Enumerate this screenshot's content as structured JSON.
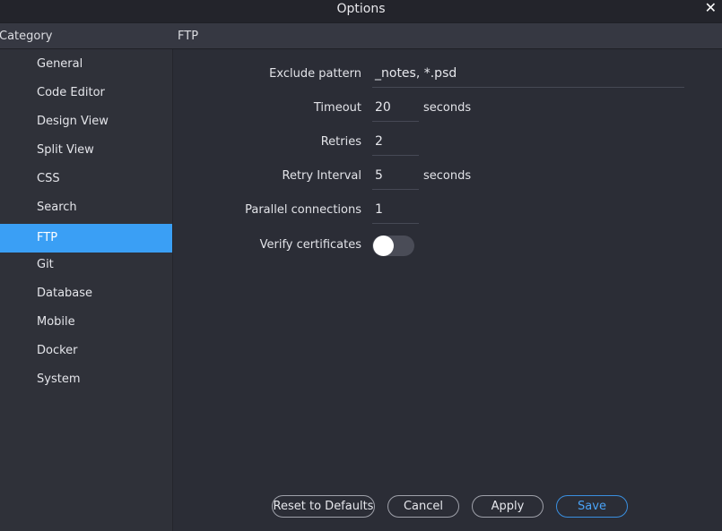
{
  "window": {
    "title": "Options",
    "close_glyph": "✕"
  },
  "header": {
    "category_label": "Category",
    "section_label": "FTP"
  },
  "sidebar": {
    "active_index": 6,
    "items": [
      {
        "label": "General"
      },
      {
        "label": "Code Editor"
      },
      {
        "label": "Design View"
      },
      {
        "label": "Split View"
      },
      {
        "label": "CSS"
      },
      {
        "label": "Search"
      },
      {
        "label": "FTP"
      },
      {
        "label": "Git"
      },
      {
        "label": "Database"
      },
      {
        "label": "Mobile"
      },
      {
        "label": "Docker"
      },
      {
        "label": "System"
      }
    ]
  },
  "ftp": {
    "exclude_pattern": {
      "label": "Exclude pattern",
      "value": "_notes, *.psd"
    },
    "timeout": {
      "label": "Timeout",
      "value": "20",
      "unit": "seconds"
    },
    "retries": {
      "label": "Retries",
      "value": "2"
    },
    "retry_interval": {
      "label": "Retry Interval",
      "value": "5",
      "unit": "seconds"
    },
    "parallel_connections": {
      "label": "Parallel connections",
      "value": "1"
    },
    "verify_certificates": {
      "label": "Verify certificates",
      "enabled": false
    }
  },
  "buttons": {
    "reset_label": "Reset to Defaults",
    "cancel_label": "Cancel",
    "apply_label": "Apply",
    "save_label": "Save"
  },
  "colors": {
    "accent": "#3a9ff5",
    "background": "#2b2d36",
    "sidebar": "#2f3139",
    "toggle_off": "#4a4c57"
  }
}
